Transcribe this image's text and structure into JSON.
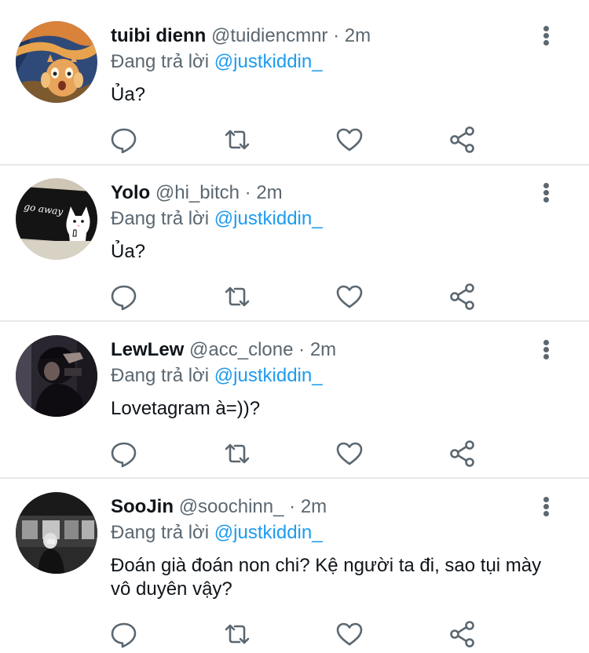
{
  "reply_prefix": "Đang trả lời",
  "separator": "·",
  "colors": {
    "accent": "#1d9bf0",
    "secondary": "#5b6770",
    "divider": "#e6e8ea"
  },
  "icons": {
    "reply": "reply-icon",
    "retweet": "retweet-icon",
    "like": "heart-icon",
    "share": "share-icon",
    "more": "more-vertical-icon"
  },
  "tweets": [
    {
      "name": "tuibi dienn",
      "handle": "@tuidiencmnr",
      "time": "2m",
      "reply_to": "@justkiddin_",
      "text": "Ủa?"
    },
    {
      "name": "Yolo",
      "handle": "@hi_bitch",
      "time": "2m",
      "reply_to": "@justkiddin_",
      "text": "Ủa?",
      "avatar_text": "go away"
    },
    {
      "name": "LewLew",
      "handle": "@acc_clone",
      "time": "2m",
      "reply_to": "@justkiddin_",
      "text": "Lovetagram à=))?"
    },
    {
      "name": "SooJin",
      "handle": "@soochinn_",
      "time": "2m",
      "reply_to": "@justkiddin_",
      "text": "Đoán già đoán non chi? Kệ người ta đi, sao tụi mày vô duyên vậy?"
    }
  ]
}
